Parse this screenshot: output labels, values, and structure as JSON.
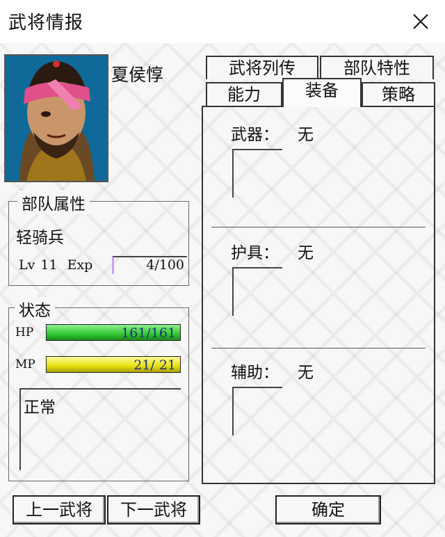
{
  "window": {
    "title": "武将情报"
  },
  "general": {
    "name": "夏侯惇"
  },
  "unit": {
    "group_title": "部队属性",
    "type": "轻骑兵",
    "lv_label": "Lv",
    "lv_value": "11",
    "exp_label": "Exp",
    "exp_value": "4/100"
  },
  "status": {
    "group_title": "状态",
    "hp_label": "HP",
    "hp_value": "161/161",
    "hp_fraction": 1.0,
    "mp_label": "MP",
    "mp_value": "21/ 21",
    "mp_fraction": 1.0,
    "condition": "正常",
    "colors": {
      "hp": "#32c832",
      "mp": "#e6e010"
    }
  },
  "tabs": {
    "top": [
      "武将列传",
      "部队特性"
    ],
    "bottom": [
      "能力",
      "装备",
      "策略"
    ],
    "active": "装备"
  },
  "equipment": {
    "weapon_label": "武器：",
    "weapon_value": "无",
    "armor_label": "护具：",
    "armor_value": "无",
    "accessory_label": "辅助：",
    "accessory_value": "无"
  },
  "buttons": {
    "prev": "上一武将",
    "next": "下一武将",
    "ok": "确定"
  }
}
